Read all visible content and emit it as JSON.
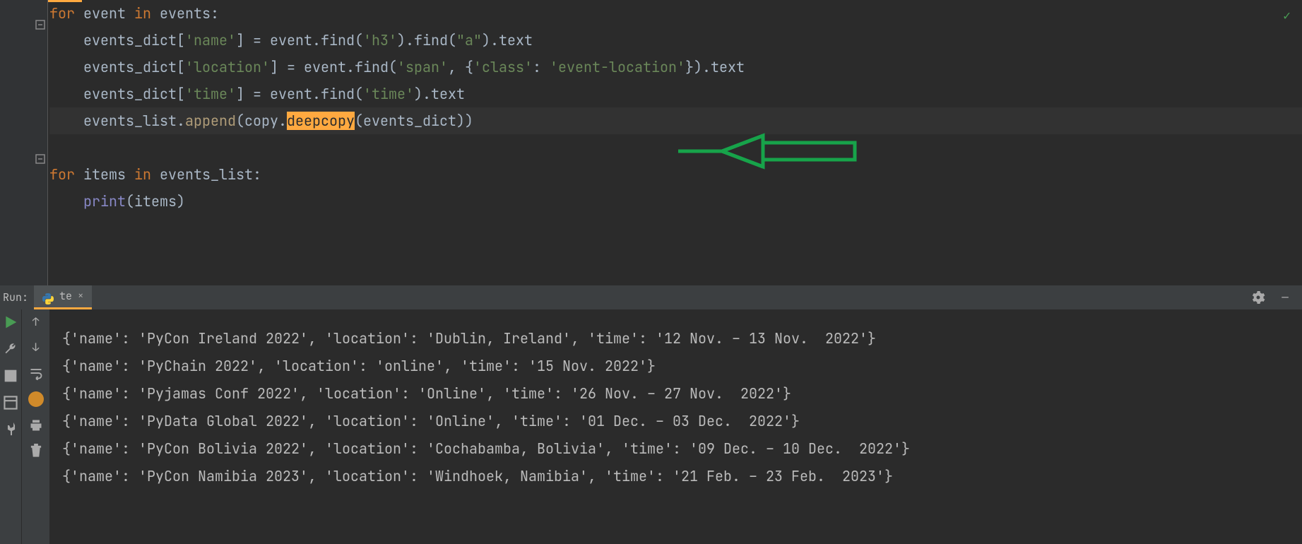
{
  "editor": {
    "lines": [
      {
        "html": "<span class='kw'>for </span><span class='txt'>event </span><span class='kw'>in </span><span class='txt'>events:</span>"
      },
      {
        "html": "    <span class='txt'>events_dict[</span><span class='str'>'name'</span><span class='txt'>] = event.find(</span><span class='str'>'h3'</span><span class='txt'>).find(</span><span class='str'>\"a\"</span><span class='txt'>).text</span>"
      },
      {
        "html": "    <span class='txt'>events_dict[</span><span class='str'>'location'</span><span class='txt'>] = event.find(</span><span class='str'>'span'</span><span class='op'>, </span><span class='txt'>{</span><span class='str'>'class'</span><span class='txt'>: </span><span class='str'>'event-location'</span><span class='txt'>}).text</span>"
      },
      {
        "html": "    <span class='txt'>events_dict[</span><span class='str'>'time'</span><span class='txt'>] = event.find(</span><span class='str'>'time'</span><span class='txt'>).text</span>"
      },
      {
        "html": "    <span class='txt'>events_list.</span><span class='fn2'>append</span><span class='txt'>(copy.</span><span class='deepcopy-box'>deepcopy</span><span class='txt'>(events_dict))</span>",
        "hl": true
      },
      {
        "html": ""
      },
      {
        "html": "<span class='kw'>for </span><span class='txt'>items </span><span class='kw'>in </span><span class='txt'>events_list:</span>"
      },
      {
        "html": "    <span class='built'>print</span><span class='txt'>(items)</span>"
      },
      {
        "html": ""
      }
    ]
  },
  "run_panel": {
    "label": "Run:",
    "tab_name": "te"
  },
  "console_lines": [
    "{'name': 'PyCon Ireland 2022', 'location': 'Dublin, Ireland', 'time': '12 Nov. – 13 Nov.  2022'}",
    "{'name': 'PyChain 2022', 'location': 'online', 'time': '15 Nov. 2022'}",
    "{'name': 'Pyjamas Conf 2022', 'location': 'Online', 'time': '26 Nov. – 27 Nov.  2022'}",
    "{'name': 'PyData Global 2022', 'location': 'Online', 'time': '01 Dec. – 03 Dec.  2022'}",
    "{'name': 'PyCon Bolivia 2022', 'location': 'Cochabamba, Bolivia', 'time': '09 Dec. – 10 Dec.  2022'}",
    "{'name': 'PyCon Namibia 2023', 'location': 'Windhoek, Namibia', 'time': '21 Feb. – 23 Feb.  2023'}"
  ]
}
